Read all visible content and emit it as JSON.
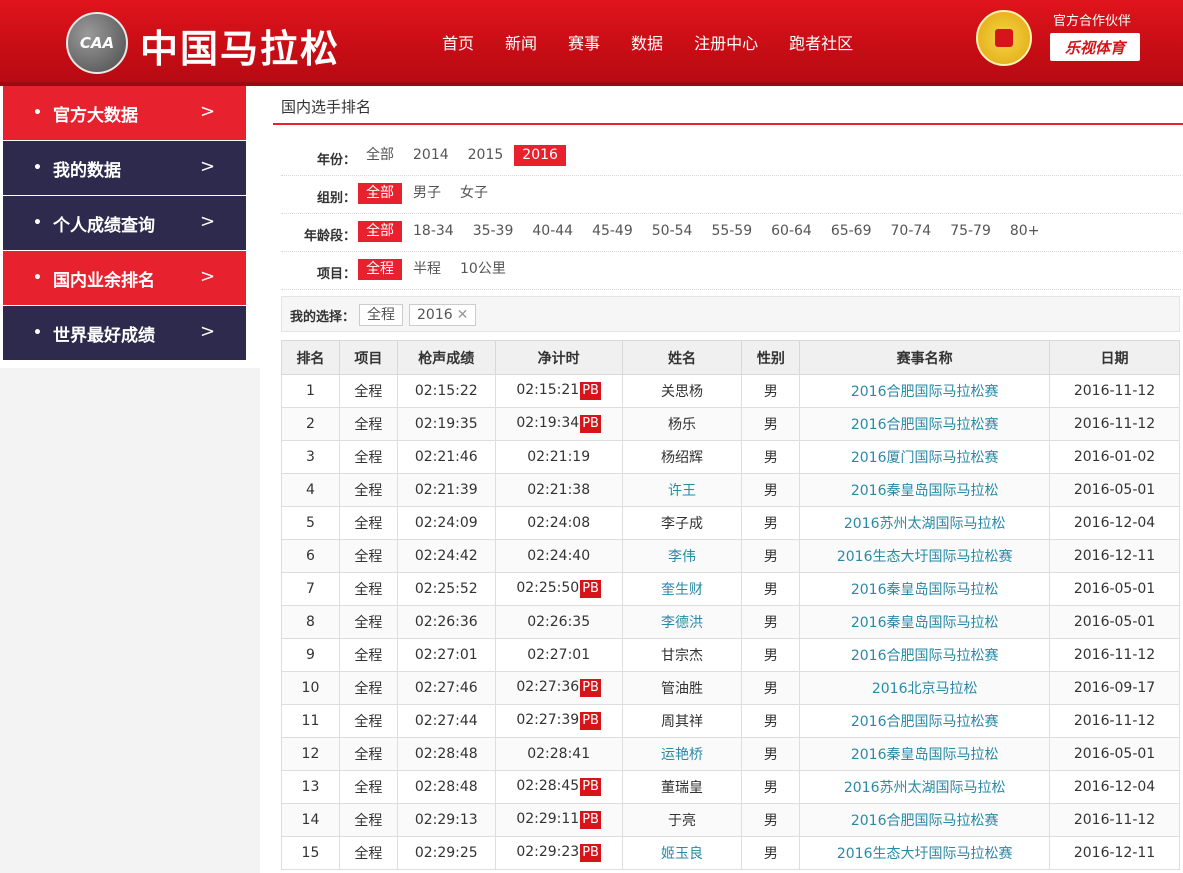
{
  "header": {
    "logo_text": "CAA",
    "site_title": "中国马拉松",
    "nav": [
      "首页",
      "新闻",
      "赛事",
      "数据",
      "注册中心",
      "跑者社区"
    ],
    "partner_label": "官方合作伙伴",
    "partner_logo": "乐视体育",
    "colors": {
      "brand_red": "#e0141c",
      "dark_red": "#b50a12"
    }
  },
  "sidebar": {
    "items": [
      {
        "label": "官方大数据",
        "active": true
      },
      {
        "label": "我的数据",
        "active": false
      },
      {
        "label": "个人成绩查询",
        "active": false
      },
      {
        "label": "国内业余排名",
        "active": true
      },
      {
        "label": "世界最好成绩",
        "active": false
      }
    ],
    "colors": {
      "active": "#e8212e",
      "inactive": "#2e2a4d"
    }
  },
  "main": {
    "title": "国内选手排名",
    "filters": {
      "year": {
        "label": "年份：",
        "options": [
          "全部",
          "2014",
          "2015",
          "2016"
        ],
        "selected": "2016"
      },
      "group": {
        "label": "组别：",
        "options": [
          "全部",
          "男子",
          "女子"
        ],
        "selected": "全部"
      },
      "age": {
        "label": "年龄段：",
        "options": [
          "全部",
          "18-34",
          "35-39",
          "40-44",
          "45-49",
          "50-54",
          "55-59",
          "60-64",
          "65-69",
          "70-74",
          "75-79",
          "80+"
        ],
        "selected": "全部"
      },
      "event": {
        "label": "项目：",
        "options": [
          "全程",
          "半程",
          "10公里"
        ],
        "selected": "全程"
      }
    },
    "choices": {
      "label": "我的选择：",
      "items": [
        "全程",
        "2016"
      ],
      "close_symbol": "✕"
    },
    "table": {
      "headers": [
        "排名",
        "项目",
        "枪声成绩",
        "净计时",
        "姓名",
        "性别",
        "赛事名称",
        "日期"
      ],
      "pb_label": "PB",
      "rows": [
        {
          "rank": "1",
          "event": "全程",
          "gun": "02:15:22",
          "net": "02:15:21",
          "pb": true,
          "name": "关思杨",
          "name_link": false,
          "gender": "男",
          "race": "2016合肥国际马拉松赛",
          "date": "2016-11-12"
        },
        {
          "rank": "2",
          "event": "全程",
          "gun": "02:19:35",
          "net": "02:19:34",
          "pb": true,
          "name": "杨乐",
          "name_link": false,
          "gender": "男",
          "race": "2016合肥国际马拉松赛",
          "date": "2016-11-12"
        },
        {
          "rank": "3",
          "event": "全程",
          "gun": "02:21:46",
          "net": "02:21:19",
          "pb": false,
          "name": "杨绍辉",
          "name_link": false,
          "gender": "男",
          "race": "2016厦门国际马拉松赛",
          "date": "2016-01-02"
        },
        {
          "rank": "4",
          "event": "全程",
          "gun": "02:21:39",
          "net": "02:21:38",
          "pb": false,
          "name": "许王",
          "name_link": true,
          "gender": "男",
          "race": "2016秦皇岛国际马拉松",
          "date": "2016-05-01"
        },
        {
          "rank": "5",
          "event": "全程",
          "gun": "02:24:09",
          "net": "02:24:08",
          "pb": false,
          "name": "李子成",
          "name_link": false,
          "gender": "男",
          "race": "2016苏州太湖国际马拉松",
          "date": "2016-12-04"
        },
        {
          "rank": "6",
          "event": "全程",
          "gun": "02:24:42",
          "net": "02:24:40",
          "pb": false,
          "name": "李伟",
          "name_link": true,
          "gender": "男",
          "race": "2016生态大圩国际马拉松赛",
          "date": "2016-12-11"
        },
        {
          "rank": "7",
          "event": "全程",
          "gun": "02:25:52",
          "net": "02:25:50",
          "pb": true,
          "name": "奎生财",
          "name_link": true,
          "gender": "男",
          "race": "2016秦皇岛国际马拉松",
          "date": "2016-05-01"
        },
        {
          "rank": "8",
          "event": "全程",
          "gun": "02:26:36",
          "net": "02:26:35",
          "pb": false,
          "name": "李德洪",
          "name_link": true,
          "gender": "男",
          "race": "2016秦皇岛国际马拉松",
          "date": "2016-05-01"
        },
        {
          "rank": "9",
          "event": "全程",
          "gun": "02:27:01",
          "net": "02:27:01",
          "pb": false,
          "name": "甘宗杰",
          "name_link": false,
          "gender": "男",
          "race": "2016合肥国际马拉松赛",
          "date": "2016-11-12"
        },
        {
          "rank": "10",
          "event": "全程",
          "gun": "02:27:46",
          "net": "02:27:36",
          "pb": true,
          "name": "管油胜",
          "name_link": false,
          "gender": "男",
          "race": "2016北京马拉松",
          "date": "2016-09-17"
        },
        {
          "rank": "11",
          "event": "全程",
          "gun": "02:27:44",
          "net": "02:27:39",
          "pb": true,
          "name": "周其祥",
          "name_link": false,
          "gender": "男",
          "race": "2016合肥国际马拉松赛",
          "date": "2016-11-12"
        },
        {
          "rank": "12",
          "event": "全程",
          "gun": "02:28:48",
          "net": "02:28:41",
          "pb": false,
          "name": "运艳桥",
          "name_link": true,
          "gender": "男",
          "race": "2016秦皇岛国际马拉松",
          "date": "2016-05-01"
        },
        {
          "rank": "13",
          "event": "全程",
          "gun": "02:28:48",
          "net": "02:28:45",
          "pb": true,
          "name": "董瑞皇",
          "name_link": false,
          "gender": "男",
          "race": "2016苏州太湖国际马拉松",
          "date": "2016-12-04"
        },
        {
          "rank": "14",
          "event": "全程",
          "gun": "02:29:13",
          "net": "02:29:11",
          "pb": true,
          "name": "于亮",
          "name_link": false,
          "gender": "男",
          "race": "2016合肥国际马拉松赛",
          "date": "2016-11-12"
        },
        {
          "rank": "15",
          "event": "全程",
          "gun": "02:29:25",
          "net": "02:29:23",
          "pb": true,
          "name": "姬玉良",
          "name_link": true,
          "gender": "男",
          "race": "2016生态大圩国际马拉松赛",
          "date": "2016-12-11"
        }
      ]
    }
  }
}
